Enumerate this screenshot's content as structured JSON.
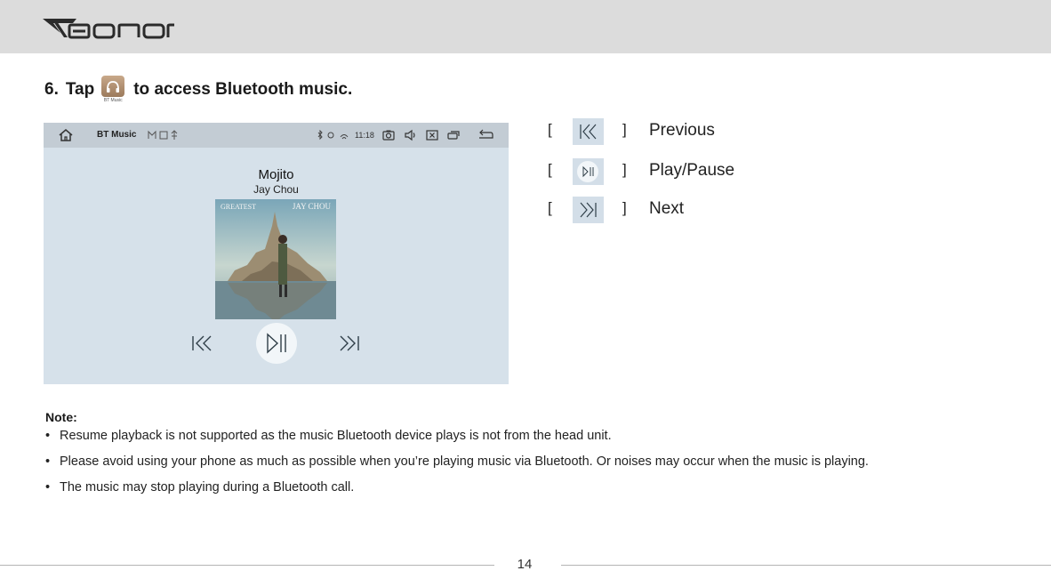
{
  "header": {
    "brand": "EONON"
  },
  "step": {
    "number": "6.",
    "before_icon": "Tap",
    "icon": "bt-music-app-icon",
    "icon_caption": "BT Music",
    "after_icon": "to access Bluetooth music."
  },
  "screen": {
    "statusbar": {
      "title": "BT Music",
      "time": "11:18"
    },
    "song_title": "Mojito",
    "artist": "Jay Chou",
    "cover": {
      "left_text": "GREATEST",
      "right_text": "JAY CHOU"
    }
  },
  "legend": [
    {
      "label": "Previous",
      "icon": "previous-icon"
    },
    {
      "label": "Play/Pause",
      "icon": "play-pause-icon"
    },
    {
      "label": "Next",
      "icon": "next-icon"
    }
  ],
  "note": {
    "heading": "Note:",
    "items": [
      "Resume playback is not supported as the music Bluetooth device plays is not from the head unit.",
      "Please avoid using your phone as much as possible when you’re playing music via Bluetooth. Or noises may occur when the music is playing.",
      "The music may stop playing during a Bluetooth call."
    ]
  },
  "footer": {
    "page_number": "14"
  }
}
